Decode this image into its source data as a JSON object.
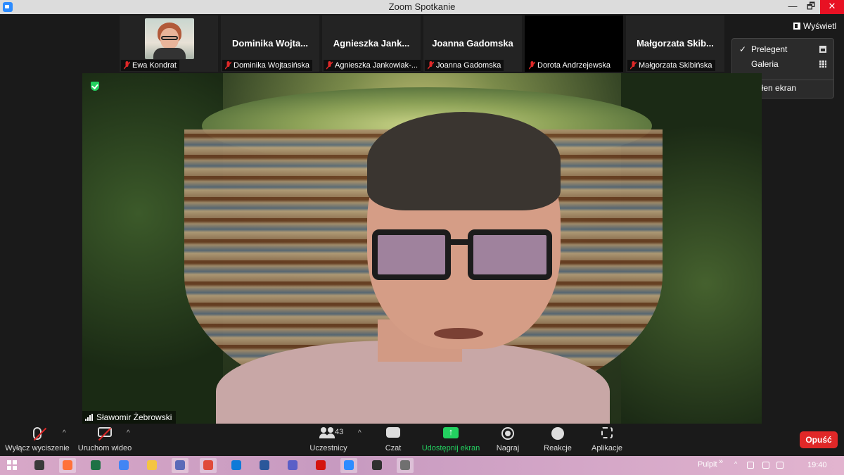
{
  "window": {
    "title": "Zoom Spotkanie",
    "controls": {
      "minimize": "—",
      "maximize": "🗗",
      "close": "✕"
    }
  },
  "participants_strip": [
    {
      "display": "",
      "label": "Ewa Kondrat",
      "has_video": true,
      "muted": true
    },
    {
      "display": "Dominika  Wojta...",
      "label": "Dominika Wojtasińska",
      "has_video": false,
      "muted": true
    },
    {
      "display": "Agnieszka  Jank...",
      "label": "Agnieszka Jankowiak-...",
      "has_video": false,
      "muted": true
    },
    {
      "display": "Joanna Gadomska",
      "label": "Joanna Gadomska",
      "has_video": false,
      "muted": true
    },
    {
      "display": "",
      "label": "Dorota Andrzejewska",
      "has_video": false,
      "black": true,
      "muted": true
    },
    {
      "display": "Małgorzata  Skib...",
      "label": "Małgorzata Skibińska",
      "has_video": false,
      "muted": true
    }
  ],
  "view": {
    "button_label": "Wyświetl",
    "menu": [
      {
        "label": "Prelegent",
        "checked": true,
        "icon": "speaker-view-icon"
      },
      {
        "label": "Galeria",
        "checked": false,
        "icon": "gallery-view-icon"
      },
      {
        "label": "Pełen ekran",
        "checked": false,
        "icon": ""
      }
    ],
    "checkmark": "✓"
  },
  "main_video": {
    "speaker_name": "Sławomir Żebrowski",
    "encryption_icon": "shield-icon"
  },
  "toolbar": {
    "mute_label": "Wyłącz wyciszenie",
    "video_label": "Uruchom wideo",
    "participants_label": "Uczestnicy",
    "participants_count": "43",
    "chat_label": "Czat",
    "share_label": "Udostępnij ekran",
    "record_label": "Nagraj",
    "reactions_label": "Reakcje",
    "apps_label": "Aplikacje",
    "leave_label": "Opuść",
    "caret": "^"
  },
  "taskbar": {
    "apps": [
      {
        "name": "archive-app-icon",
        "color": "#3a3a3a"
      },
      {
        "name": "firefox-icon",
        "color": "#ff7139",
        "active": true
      },
      {
        "name": "excel-icon",
        "color": "#1e7145"
      },
      {
        "name": "chrome-icon",
        "color": "#4285f4"
      },
      {
        "name": "file-explorer-icon",
        "color": "#f4c542"
      },
      {
        "name": "word-like-icon",
        "color": "#5a6ab8",
        "active": true
      },
      {
        "name": "app-red-icon",
        "color": "#e04a3a",
        "active": true
      },
      {
        "name": "edge-icon",
        "color": "#0f7ad8"
      },
      {
        "name": "word-icon",
        "color": "#2b579a"
      },
      {
        "name": "teams-icon",
        "color": "#5b5fc7"
      },
      {
        "name": "acrobat-icon",
        "color": "#d4150f"
      },
      {
        "name": "zoom-icon",
        "color": "#2d8cff",
        "active": true
      },
      {
        "name": "obs-icon",
        "color": "#303030"
      },
      {
        "name": "app-mic-icon",
        "color": "#707070",
        "active": true
      }
    ],
    "desktop_label": "Pulpit",
    "chevrons": "»",
    "clock": "19:40"
  }
}
